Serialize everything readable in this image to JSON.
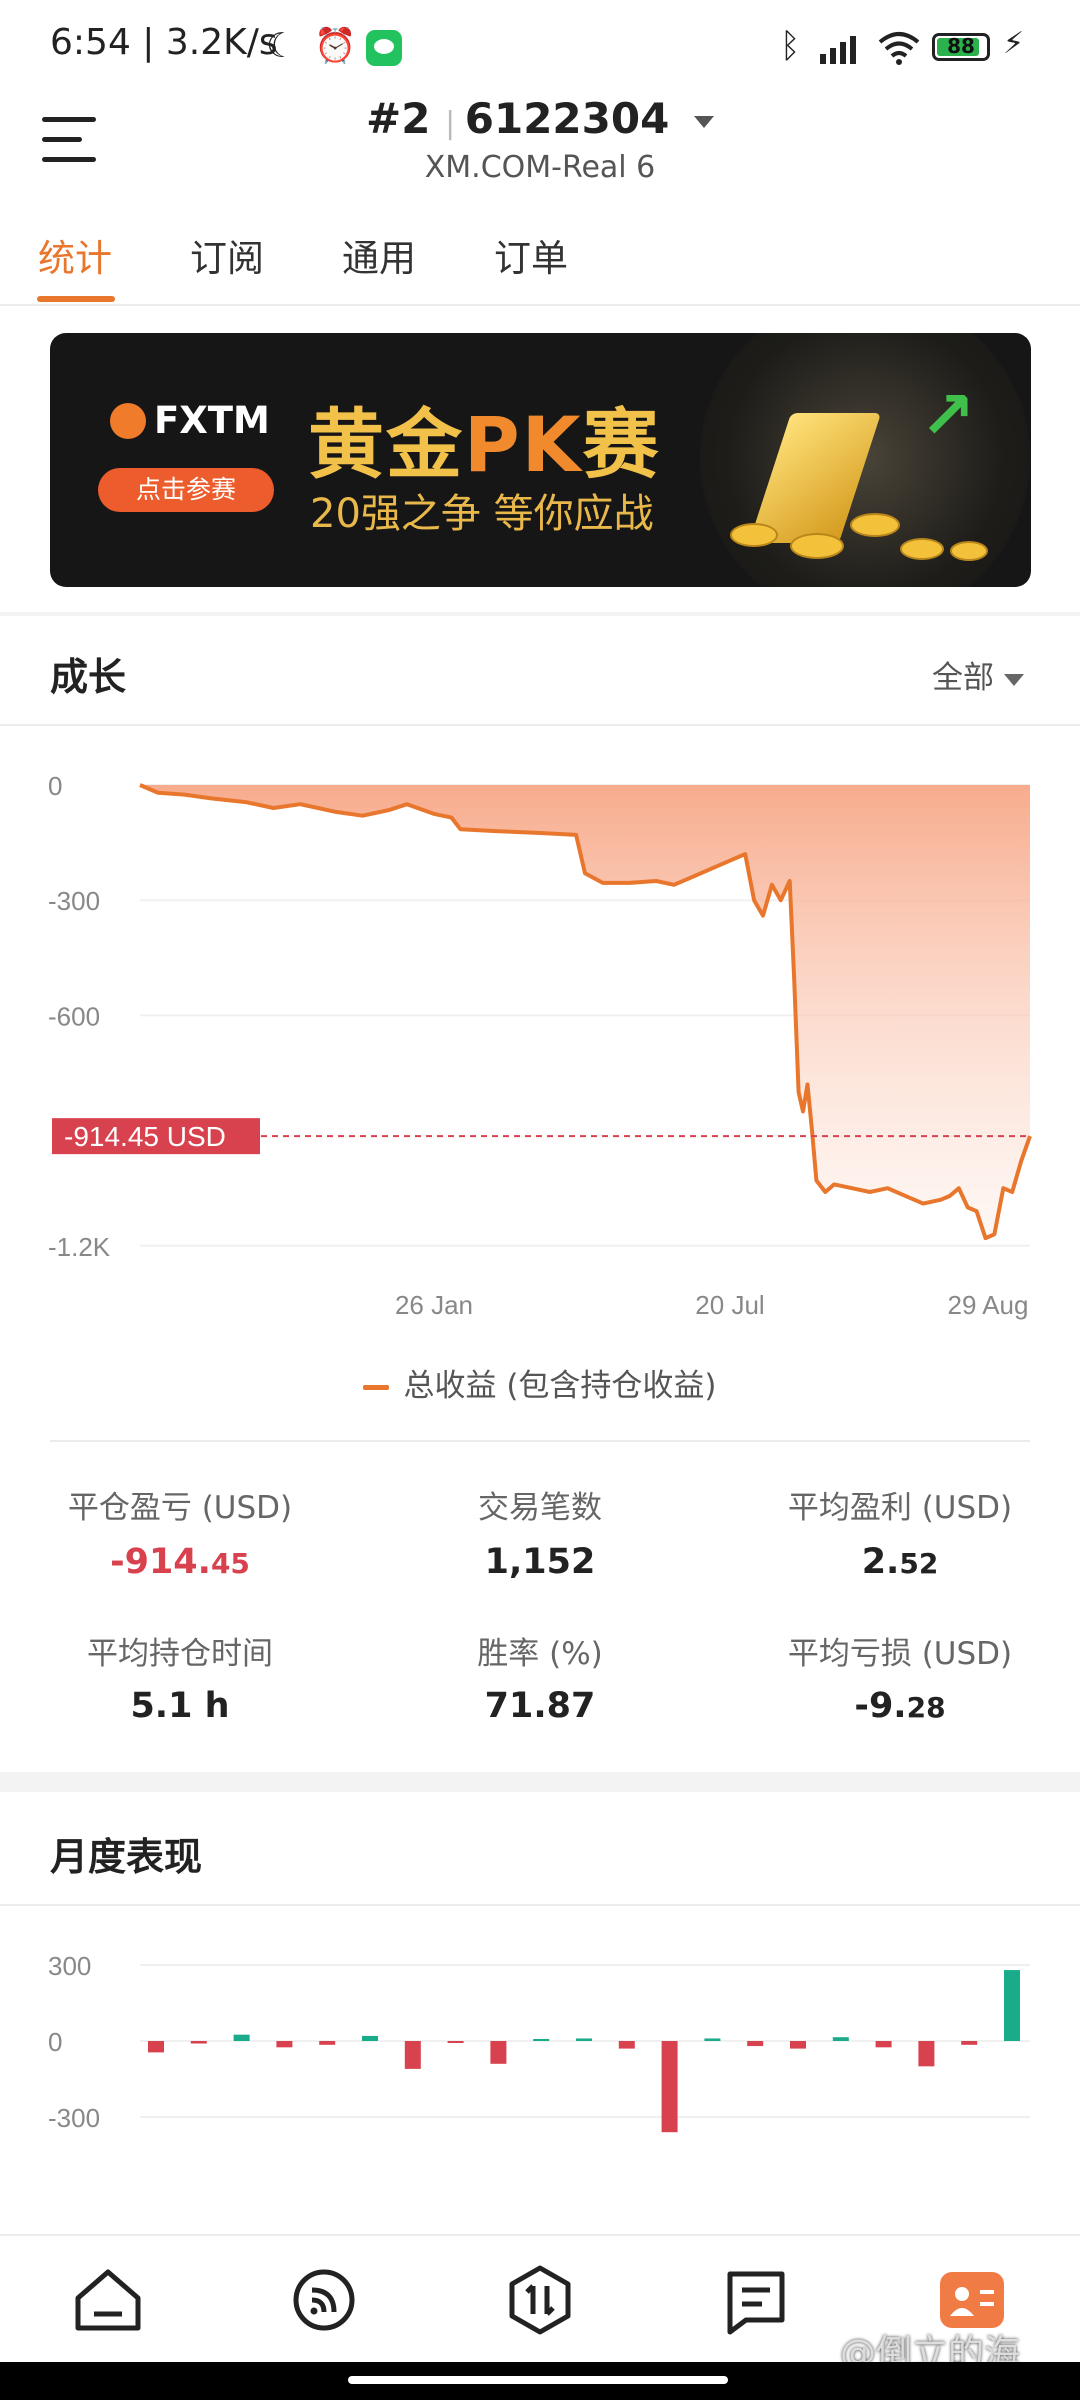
{
  "status_bar": {
    "time": "6:54",
    "net_speed": "3.2K/s",
    "battery": "88",
    "icons": [
      "moon-icon",
      "alarm-icon",
      "wechat-icon",
      "bluetooth-icon",
      "signal-icon",
      "wifi-icon",
      "battery-icon",
      "charging-icon"
    ]
  },
  "header": {
    "account_index": "#2",
    "account_number": "6122304",
    "server": "XM.COM-Real 6"
  },
  "tabs": [
    {
      "label": "统计",
      "active": true
    },
    {
      "label": "订阅",
      "active": false
    },
    {
      "label": "通用",
      "active": false
    },
    {
      "label": "订单",
      "active": false
    }
  ],
  "banner": {
    "brand": "FXTM",
    "cta": "点击参赛",
    "title_pre": "黄金",
    "title_pk": "PK",
    "title_post": "赛",
    "subtitle": "20强之争  等你应战"
  },
  "growth": {
    "title": "成长",
    "range_label": "全部",
    "current_label": "-914.45 USD",
    "legend": "总收益 (包含持仓收益)"
  },
  "accent_color": "#e8762c",
  "negative_color": "#d8424e",
  "positive_color": "#1aab8b",
  "chart_data": [
    {
      "type": "area",
      "y_ticks": [
        "0",
        "-300",
        "-600",
        "-1.2K"
      ],
      "x_ticks": [
        "26 Jan",
        "20 Jul",
        "29 Aug"
      ],
      "ylim": [
        -1250,
        0
      ],
      "current_value": -914.45,
      "series": [
        {
          "name": "总收益 (包含持仓收益)",
          "x": [
            0,
            0.02,
            0.05,
            0.08,
            0.12,
            0.15,
            0.18,
            0.2,
            0.22,
            0.25,
            0.28,
            0.3,
            0.33,
            0.35,
            0.36,
            0.4,
            0.45,
            0.49,
            0.5,
            0.52,
            0.55,
            0.58,
            0.6,
            0.62,
            0.65,
            0.68,
            0.69,
            0.7,
            0.71,
            0.72,
            0.73,
            0.735,
            0.74,
            0.745,
            0.75,
            0.755,
            0.76,
            0.77,
            0.78,
            0.8,
            0.82,
            0.84,
            0.86,
            0.88,
            0.9,
            0.91,
            0.92,
            0.93,
            0.94,
            0.95,
            0.96,
            0.97,
            0.98,
            0.99,
            1.0
          ],
          "values": [
            0,
            -20,
            -25,
            -35,
            -45,
            -60,
            -50,
            -60,
            -70,
            -80,
            -65,
            -50,
            -75,
            -85,
            -115,
            -120,
            -125,
            -130,
            -230,
            -255,
            -255,
            -250,
            -260,
            -240,
            -210,
            -180,
            -300,
            -340,
            -260,
            -300,
            -250,
            -500,
            -800,
            -850,
            -780,
            -900,
            -1030,
            -1060,
            -1040,
            -1050,
            -1060,
            -1050,
            -1070,
            -1090,
            -1080,
            -1070,
            -1050,
            -1100,
            -1110,
            -1180,
            -1170,
            -1050,
            -1060,
            -980,
            -914.45
          ]
        }
      ]
    },
    {
      "type": "bar",
      "title": "月度表现",
      "y_ticks": [
        "300",
        "0",
        "-300"
      ],
      "ylim": [
        -360,
        340
      ],
      "values": [
        -45,
        -10,
        25,
        -25,
        -15,
        20,
        -110,
        -5,
        -90,
        8,
        10,
        -30,
        -360,
        10,
        -20,
        -30,
        15,
        -25,
        -100,
        -15,
        280
      ]
    }
  ],
  "stats": [
    {
      "label": "平仓盈亏 (USD)",
      "int": "-914.",
      "dec": "45",
      "negative": true
    },
    {
      "label": "交易笔数",
      "int": "1,152",
      "dec": "",
      "negative": false
    },
    {
      "label": "平均盈利 (USD)",
      "int": "2.",
      "dec": "52",
      "negative": false
    },
    {
      "label": "平均持仓时间",
      "int": "5.1 h",
      "dec": "",
      "negative": false
    },
    {
      "label": "胜率 (%)",
      "int": "71.87",
      "dec": "",
      "negative": false
    },
    {
      "label": "平均亏损 (USD)",
      "int": "-9.",
      "dec": "28",
      "negative": false
    }
  ],
  "monthly": {
    "title": "月度表现"
  },
  "bottom_nav": [
    {
      "icon": "home-icon"
    },
    {
      "icon": "signal-feed-icon"
    },
    {
      "icon": "trade-icon"
    },
    {
      "icon": "orders-icon"
    },
    {
      "icon": "profile-icon"
    }
  ],
  "watermark": "@倒立的海"
}
